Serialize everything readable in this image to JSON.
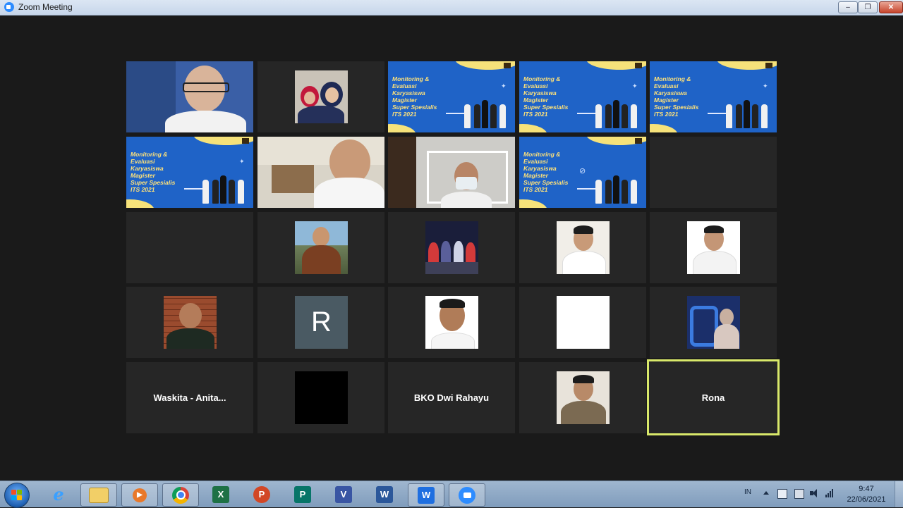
{
  "window": {
    "title": "Zoom Meeting",
    "minimize_label": "–",
    "maximize_label": "❐",
    "close_label": "✕"
  },
  "slide": {
    "text": "Monitoring &\nEvaluasi\nKaryasiswa\nMagister\nSuper Spesialis\nITS 2021"
  },
  "participants": {
    "r3c1_name": "",
    "r4c2_initial": "R",
    "r5c1_name": "Waskita  -  Anita...",
    "r5c3_name": "BKO Dwi Rahayu",
    "r5c5_name": "Rona"
  },
  "colors": {
    "active_speaker_border": "#d8e86a",
    "tile_background": "#262626",
    "slide_blue": "#1f63c7",
    "slide_yellow": "#f6e27a"
  },
  "taskbar": {
    "icons": [
      "start-icon",
      "internet-explorer-icon",
      "file-explorer-icon",
      "media-player-icon",
      "chrome-icon",
      "excel-icon",
      "powerpoint-icon",
      "publisher-icon",
      "visio-icon",
      "word-icon",
      "wps-icon",
      "zoom-icon"
    ],
    "labels": {
      "excel": "X",
      "powerpoint": "P",
      "publisher": "P",
      "visio": "V",
      "word": "W",
      "wps": "W"
    },
    "language": "IN",
    "time": "9:47",
    "date": "22/06/2021"
  }
}
